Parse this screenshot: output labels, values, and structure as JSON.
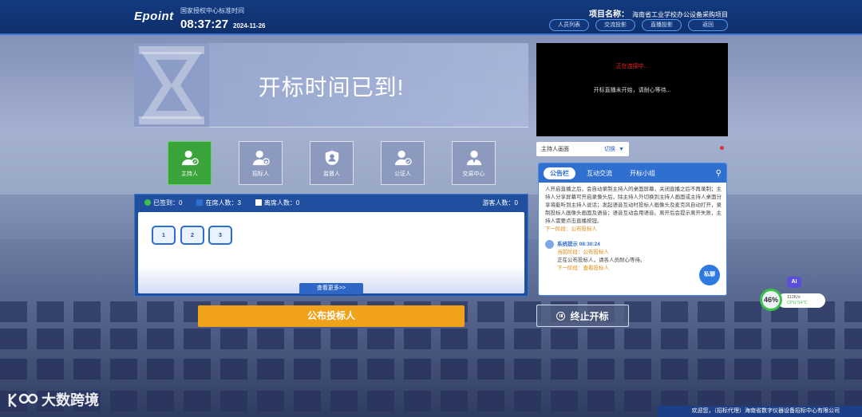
{
  "header": {
    "logo": "Epoint",
    "time_label": "国家授权中心标准时间",
    "time": "08:37:27",
    "date": "2024-11-26",
    "project_label": "项目名称：",
    "project_name": "海南省工业学校办公设备采购项目",
    "buttons": [
      "人员列表",
      "交流投影",
      "直播投影",
      "返回"
    ]
  },
  "banner": {
    "text": "开标时间已到!"
  },
  "roles": [
    {
      "label": "主持人",
      "icon": "host-icon",
      "active": true
    },
    {
      "label": "招标人",
      "icon": "tenderer-icon",
      "active": false
    },
    {
      "label": "监督人",
      "icon": "supervisor-icon",
      "active": false
    },
    {
      "label": "公证人",
      "icon": "notary-icon",
      "active": false
    },
    {
      "label": "交易中心",
      "icon": "trading-center-icon",
      "active": false
    }
  ],
  "attendance": {
    "signed": "已签到：0",
    "online": "在席人数：3",
    "offline": "离席人数：0",
    "guests": "游客人数：0",
    "seats": [
      "1",
      "2",
      "3"
    ],
    "more": "查看更多>>"
  },
  "publish_button": "公布投标人",
  "video": {
    "error": "正在连接中...",
    "message": "开标直播未开始，请耐心等待..."
  },
  "host_select": {
    "value": "主持人画面",
    "switch_label": "切换"
  },
  "notice": {
    "tabs": [
      "公告栏",
      "互动交流",
      "开标小组"
    ],
    "active_tab": "公告栏",
    "intro": "人开启直播之后，会自动录制主持人的桌面屏幕，关闭直播之后不再录制；主持人分享屏幕可开启录像头后，除主持人外切换到主持人画面或主持人桌面分享将能听到主持人说话；发起语音互动时投标人画像头及麦克风自动打开，录制投标人画像头画面及语音；语音互动会用语音。离开后会提示离开失败，主持人需要点击直播按钮。",
    "next_step_1": "下一阶段：公布投标人",
    "sys_title": "系统提示 08:30:24",
    "sys_current": "当前阶段：公布投标人",
    "sys_text": "正在公布投标人，请各人员耐心等待。",
    "next_step_2": "下一阶段：查看投标人",
    "private_chat": "私聊"
  },
  "stop_button": "终止开标",
  "perf": {
    "percent": "46%",
    "speed": "112K/s",
    "cpu": "CPU 54℃",
    "ai": "AI"
  },
  "footer": "欢迎您，（招标代理）海南省数字仪器设备招标中心有限公司",
  "watermark": "大数跨境"
}
